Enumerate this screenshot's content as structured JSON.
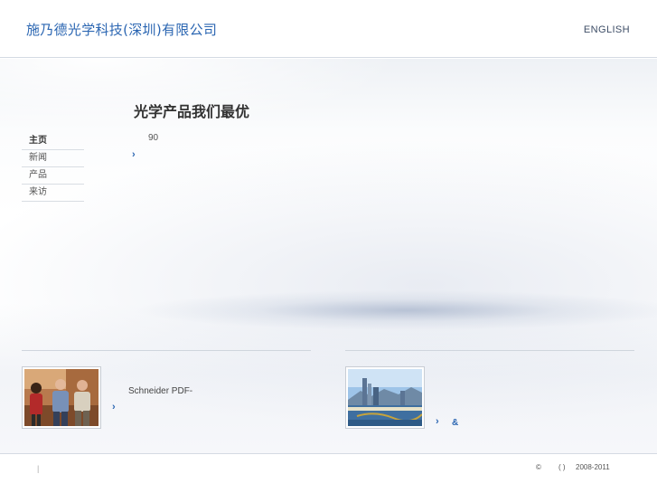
{
  "header": {
    "company_name": "施乃德光学科技(深圳)有限公司",
    "language_link": "ENGLISH"
  },
  "nav": {
    "items": [
      {
        "label": "主页",
        "active": true
      },
      {
        "label": "新闻",
        "active": false
      },
      {
        "label": "产品",
        "active": false
      },
      {
        "label": "来访",
        "active": false
      }
    ]
  },
  "main": {
    "headline": "光学产品我们最优",
    "intro_text": "90",
    "more_icon": "chevron-right-icon"
  },
  "left_panel": {
    "photo_icon": "team-photo",
    "link_text": "Schneider PDF-",
    "more_icon": "chevron-right-icon"
  },
  "right_panel": {
    "photo_icon": "city-skyline-photo",
    "link_text": "&",
    "more_icon": "chevron-right-icon"
  },
  "footer": {
    "separator": "|",
    "copyright_symbol": "©",
    "parentheses": "(   )",
    "years": "2008-2011"
  },
  "colors": {
    "accent": "#2b66b2",
    "text": "#555555",
    "divider": "#d4dae3"
  }
}
